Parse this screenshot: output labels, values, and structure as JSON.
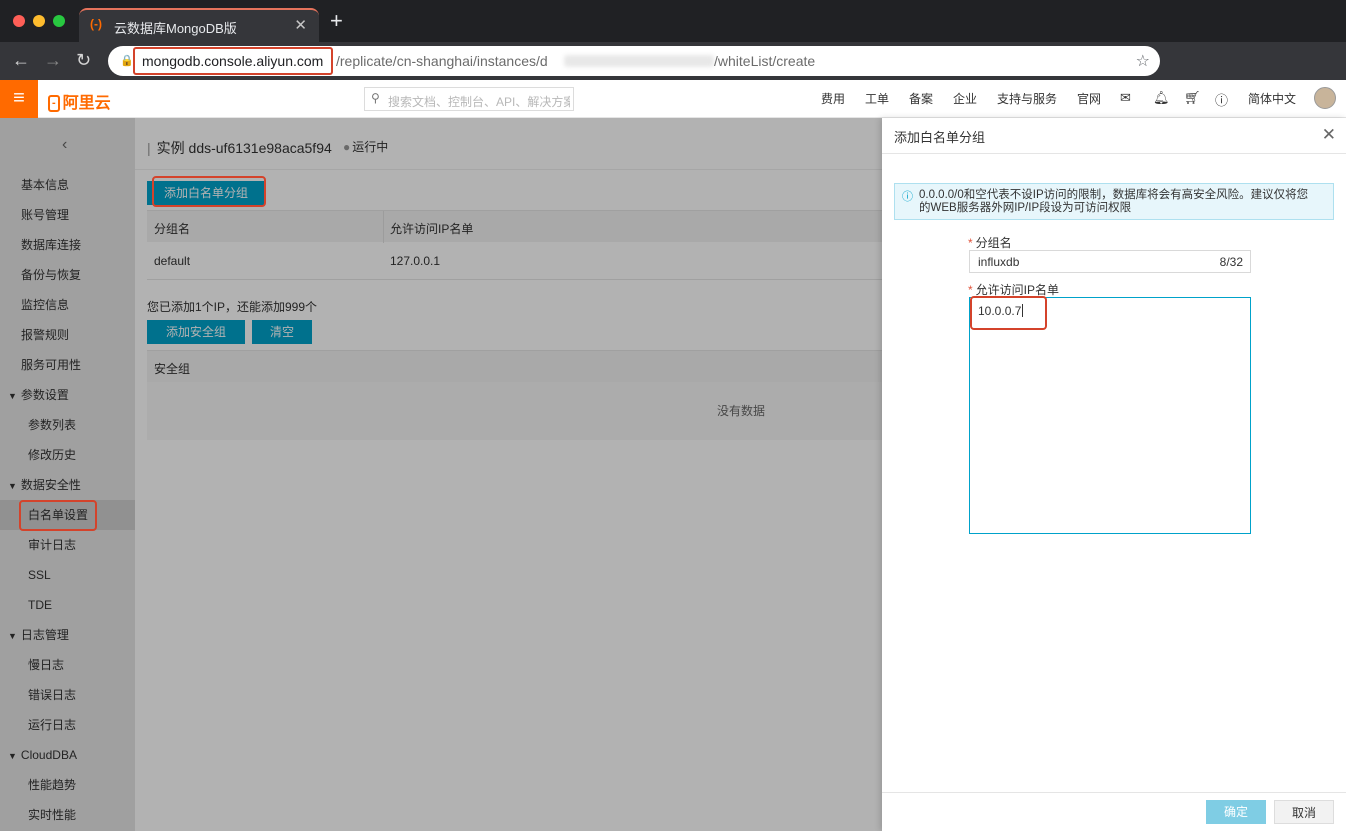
{
  "browser": {
    "tab_title": "云数据库MongoDB版",
    "new_tab": "+",
    "tab_close": "✕",
    "url_host": "mongodb.console.aliyun.com",
    "url_path": "/replicate/cn-shanghai/instances/d",
    "url_tail": "/whiteList/create"
  },
  "topbar": {
    "logo": "阿里云",
    "search_placeholder": "搜索文档、控制台、API、解决方案",
    "nav": [
      "费用",
      "工单",
      "备案",
      "企业",
      "支持与服务",
      "官网"
    ],
    "language": "简体中文"
  },
  "sidebar": {
    "items": [
      {
        "label": "基本信息"
      },
      {
        "label": "账号管理"
      },
      {
        "label": "数据库连接"
      },
      {
        "label": "备份与恢复"
      },
      {
        "label": "监控信息"
      },
      {
        "label": "报警规则"
      },
      {
        "label": "服务可用性"
      },
      {
        "label": "参数设置"
      },
      {
        "label": "参数列表"
      },
      {
        "label": "修改历史"
      },
      {
        "label": "数据安全性"
      },
      {
        "label": "白名单设置"
      },
      {
        "label": "审计日志"
      },
      {
        "label": "SSL"
      },
      {
        "label": "TDE"
      },
      {
        "label": "日志管理"
      },
      {
        "label": "慢日志"
      },
      {
        "label": "错误日志"
      },
      {
        "label": "运行日志"
      },
      {
        "label": "CloudDBA"
      },
      {
        "label": "性能趋势"
      },
      {
        "label": "实时性能"
      }
    ]
  },
  "main": {
    "instance_prefix": "实例",
    "instance_id": "dds-uf6131e98aca5f94",
    "status": "运行中",
    "add_group_button": "添加白名单分组",
    "table_headers": [
      "分组名",
      "允许访问IP名单"
    ],
    "rows": [
      {
        "group": "default",
        "ips": "127.0.0.1"
      }
    ],
    "ip_count_text": "您已添加1个IP，还能添加999个",
    "add_sg_button": "添加安全组",
    "clear_button": "清空",
    "sg_header": "安全组",
    "empty_text": "没有数据"
  },
  "drawer": {
    "title": "添加白名单分组",
    "notice": "0.0.0.0/0和空代表不设IP访问的限制，数据库将会有高安全风险。建议仅将您的WEB服务器外网IP/IP段设为可访问权限",
    "name_label": "分组名",
    "name_value": "influxdb",
    "name_counter": "8/32",
    "ip_label": "允许访问IP名单",
    "ip_value": "10.0.0.7",
    "ok_button": "确定",
    "cancel_button": "取消"
  },
  "colors": {
    "brand": "#ff6a00",
    "primary": "#00a2ca",
    "highlight": "#d4432b"
  }
}
